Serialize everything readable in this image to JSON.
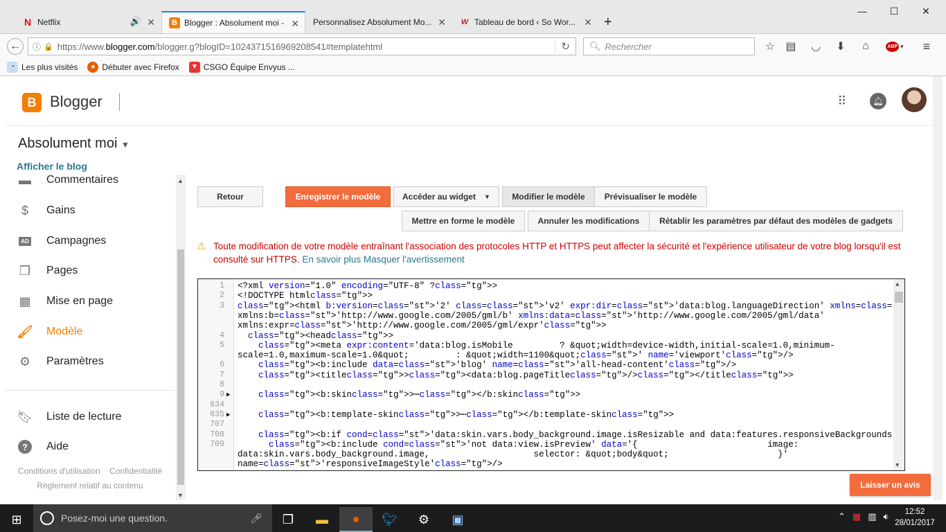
{
  "browser": {
    "tabs": [
      {
        "title": "Netflix",
        "icon": "netflix-icon",
        "has_audio": true
      },
      {
        "title": "Blogger : Absolument moi -",
        "icon": "blogger-icon",
        "active": true
      },
      {
        "title": "Personnalisez Absolument Mo...",
        "icon": ""
      },
      {
        "title": "Tableau de bord ‹ So Wor...",
        "icon": "wordpress-icon"
      }
    ],
    "new_tab": "+",
    "url_prefix": "https://www.",
    "url_domain": "blogger.com",
    "url_rest": "/blogger.g?blogID=1024371516969208541#templatehtml",
    "search_placeholder": "Rechercher",
    "bookmarks": [
      {
        "label": "Les plus visités"
      },
      {
        "label": "Débuter avec Firefox"
      },
      {
        "label": "CSGO Équipe Envyus ..."
      }
    ]
  },
  "blogger": {
    "app_name": "Blogger",
    "blog_title": "Absolument moi",
    "view_blog": "Afficher le blog",
    "nav": [
      {
        "label": "Commentaires",
        "icon": "comment-icon"
      },
      {
        "label": "Gains",
        "icon": "dollar-icon"
      },
      {
        "label": "Campagnes",
        "icon": "ad-icon"
      },
      {
        "label": "Pages",
        "icon": "pages-icon"
      },
      {
        "label": "Mise en page",
        "icon": "layout-icon"
      },
      {
        "label": "Modèle",
        "icon": "paint-roller-icon",
        "active": true
      },
      {
        "label": "Paramètres",
        "icon": "gear-icon"
      },
      {
        "label": "Liste de lecture",
        "icon": "bookmark-icon"
      },
      {
        "label": "Aide",
        "icon": "help-icon"
      }
    ],
    "footer": {
      "terms": "Conditions d'utilisation",
      "privacy": "Confidentialité",
      "content_policy": "Règlement relatif au contenu"
    },
    "buttons": {
      "back": "Retour",
      "save": "Enregistrer le modèle",
      "widget": "Accéder au widget",
      "edit": "Modifier le modèle",
      "preview": "Prévisualiser le modèle",
      "format": "Mettre en forme le modèle",
      "revert": "Annuler les modifications",
      "reset_gadgets": "Rétablir les paramètres par défaut des modèles de gadgets"
    },
    "warning": {
      "text": "Toute modification de votre modèle entraînant l'association des protocoles HTTP et HTTPS peut affecter la sécurité et l'expérience utilisateur de votre blog lorsqu'il est consulté sur HTTPS.",
      "learn_more": "En savoir plus",
      "hide": "Masquer l'avertissement"
    },
    "code_lines": [
      {
        "n": "1",
        "text": "<?xml version=\"1.0\" encoding=\"UTF-8\" ?>"
      },
      {
        "n": "2",
        "text": "<!DOCTYPE html>"
      },
      {
        "n": "3",
        "text": "<html b:version='2' class='v2' expr:dir='data:blog.languageDirection' xmlns='http://www.w3.org/1999/xhtml'"
      },
      {
        "n": "",
        "text": "xmlns:b='http://www.google.com/2005/gml/b' xmlns:data='http://www.google.com/2005/gml/data'"
      },
      {
        "n": "",
        "text": "xmlns:expr='http://www.google.com/2005/gml/expr'>"
      },
      {
        "n": "4",
        "text": "  <head>"
      },
      {
        "n": "5",
        "text": "    <meta expr:content='data:blog.isMobile         ? &quot;width=device-width,initial-scale=1.0,minimum-"
      },
      {
        "n": "",
        "text": "scale=1.0,maximum-scale=1.0&quot;         : &quot;width=1100&quot;' name='viewport'/>"
      },
      {
        "n": "6",
        "text": "    <b:include data='blog' name='all-head-content'/>"
      },
      {
        "n": "7",
        "text": "    <title><data:blog.pageTitle/></title>"
      },
      {
        "n": "8",
        "text": ""
      },
      {
        "n": "9",
        "text": "    <b:skin>⋯</b:skin>",
        "fold": true
      },
      {
        "n": "634",
        "text": ""
      },
      {
        "n": "635",
        "text": "    <b:template-skin>⋯</b:template-skin>",
        "fold": true
      },
      {
        "n": "707",
        "text": ""
      },
      {
        "n": "708",
        "text": "    <b:if cond='data:skin.vars.body_background.image.isResizable and data:features.responsiveBackgrounds'>"
      },
      {
        "n": "709",
        "text": "      <b:include cond='not data:view.isPreview' data='{                         image:"
      },
      {
        "n": "",
        "text": "data:skin.vars.body_background.image,                    selector: &quot;body&quot;                     }'"
      },
      {
        "n": "",
        "text": "name='responsiveImageStyle'/>"
      }
    ],
    "review_button": "Laisser un avis"
  },
  "taskbar": {
    "search_placeholder": "Posez-moi une question.",
    "time": "12:52",
    "date": "28/01/2017"
  },
  "colors": {
    "blogger_orange": "#f57d00",
    "button_orange": "#f36c3d",
    "link_teal": "#2b7a8c",
    "warning_red": "#cc0000"
  }
}
